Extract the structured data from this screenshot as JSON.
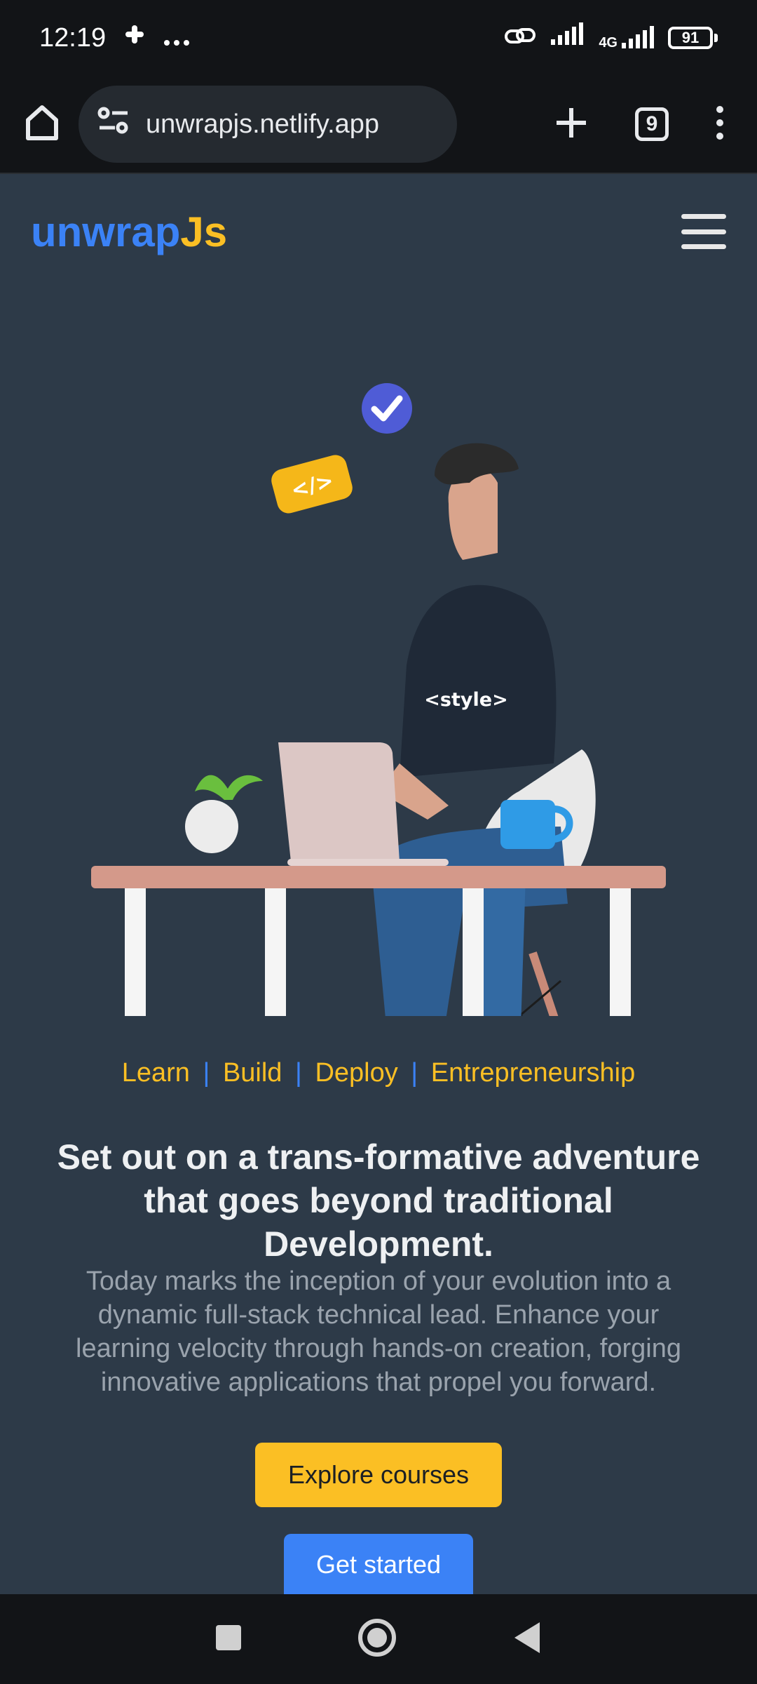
{
  "status": {
    "time": "12:19",
    "network": "4G",
    "battery": "91",
    "icons": [
      "slack-icon",
      "more-icon",
      "link-icon",
      "signal-icon",
      "4g-signal-icon",
      "battery-icon"
    ]
  },
  "browser": {
    "url": "unwrapjs.netlify.app",
    "tab_count": "9",
    "icons": [
      "home-icon",
      "site-settings-icon",
      "new-tab-icon",
      "tabs-icon",
      "menu-icon"
    ]
  },
  "site": {
    "logo_part1": "unwrap",
    "logo_part2": "Js",
    "colors": {
      "blue": "#3b82f6",
      "yellow": "#fbbf24",
      "background": "#2d3a48"
    }
  },
  "hero": {
    "illustration": "developer-at-desk",
    "hoodie_text": "<style>",
    "badge_text": "</>"
  },
  "tags": [
    "Learn",
    "Build",
    "Deploy",
    "Entrepreneurship"
  ],
  "headline": "Set out on a trans-formative adventure that goes beyond traditional Development.",
  "lead": "Today marks the inception of your evolution into a dynamic full-stack technical lead. Enhance your learning velocity through hands-on creation, forging innovative applications that propel you forward.",
  "buttons": {
    "explore": "Explore courses",
    "start": "Get started"
  },
  "navigation": [
    "recent-apps-icon",
    "home-icon",
    "back-icon"
  ]
}
